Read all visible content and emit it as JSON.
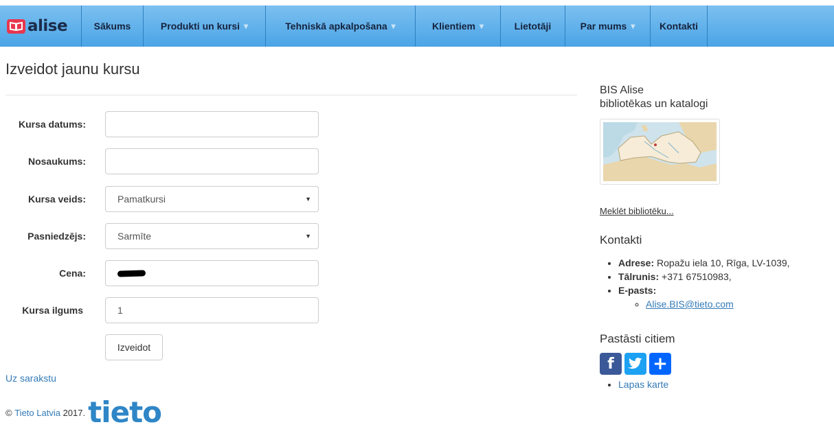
{
  "nav": {
    "brand": "alise",
    "items": [
      {
        "label": "Sākums",
        "has_caret": false
      },
      {
        "label": "Produkti un kursi",
        "has_caret": true
      },
      {
        "label": "Tehniskā apkalpošana",
        "has_caret": true
      },
      {
        "label": "Klientiem",
        "has_caret": true
      },
      {
        "label": "Lietotāji",
        "has_caret": false
      },
      {
        "label": "Par mums",
        "has_caret": true
      },
      {
        "label": "Kontakti",
        "has_caret": false
      }
    ],
    "colors": {
      "bar": "#5aaeea",
      "logo": "#e8364e"
    }
  },
  "page": {
    "title": "Izveidot jaunu kursu"
  },
  "form": {
    "date_label": "Kursa datums:",
    "date_value": "",
    "name_label": "Nosaukums:",
    "name_value": "",
    "type_label": "Kursa veids:",
    "type_value": "Pamatkursi",
    "teacher_label": "Pasniedzējs:",
    "teacher_value": "Sarmīte",
    "price_label": "Cena:",
    "duration_label": "Kursa ilgums",
    "duration_value": "1",
    "submit_label": "Izveidot"
  },
  "back_link": "Uz sarakstu",
  "footer": {
    "copyright_symbol": "©",
    "company_link": "Tieto Latvia",
    "year": "2017.",
    "logo_text": "tieto"
  },
  "sidebar": {
    "heading_line1": "BIS Alise",
    "heading_line2": "bibliotēkas un katalogi",
    "search_link": "Meklēt bibliotēku...",
    "contacts_heading": "Kontakti",
    "address_label": "Adrese:",
    "address_value": "Ropažu iela 10, Rīga, LV-1039,",
    "phone_label": "Tālrunis:",
    "phone_value": "+371 67510983,",
    "email_label": "E-pasts:",
    "email_value": "Alise.BIS@tieto.com",
    "share_heading": "Pastāsti citiem",
    "share_icons": [
      "facebook-icon",
      "twitter-icon",
      "plus-icon"
    ],
    "sitemap_link": "Lapas karte"
  }
}
